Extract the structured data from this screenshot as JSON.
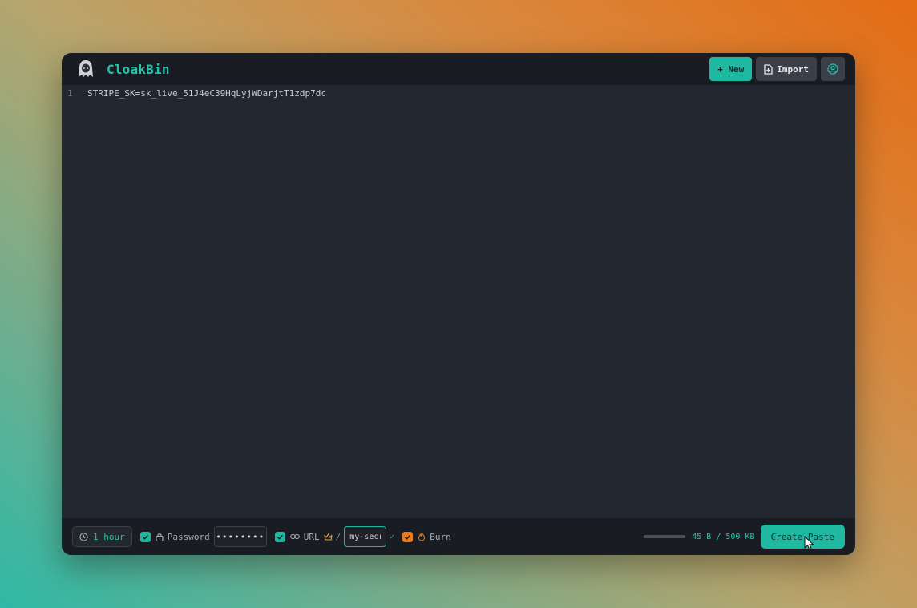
{
  "app": {
    "name": "CloakBin",
    "logo_icon": "hooded-ghost-icon"
  },
  "header": {
    "new_label": "+ New",
    "import_label": "Import",
    "import_icon": "file-import-icon",
    "avatar_icon": "user-circle-icon"
  },
  "editor": {
    "lines": [
      {
        "number": "1",
        "text": "STRIPE_SK=sk_live_51J4eC39HqLyjWDarjtT1zdp7dc"
      }
    ]
  },
  "footer": {
    "expiry_label": "1 hour",
    "password_label": "Password",
    "password_checked": true,
    "password_value": "••••••••",
    "url_label": "URL",
    "url_checked": true,
    "url_separator": "/",
    "url_value": "my-secr",
    "burn_label": "Burn",
    "burn_checked": true,
    "size_text": "45 B / 500 KB",
    "size_fraction": 0.0001,
    "create_label": "Create Paste"
  },
  "colors": {
    "accent": "#1fb9a2",
    "burn": "#e97a1d",
    "crown": "#e0a531",
    "window_bg": "#22262e",
    "header_bg": "#191c22"
  }
}
